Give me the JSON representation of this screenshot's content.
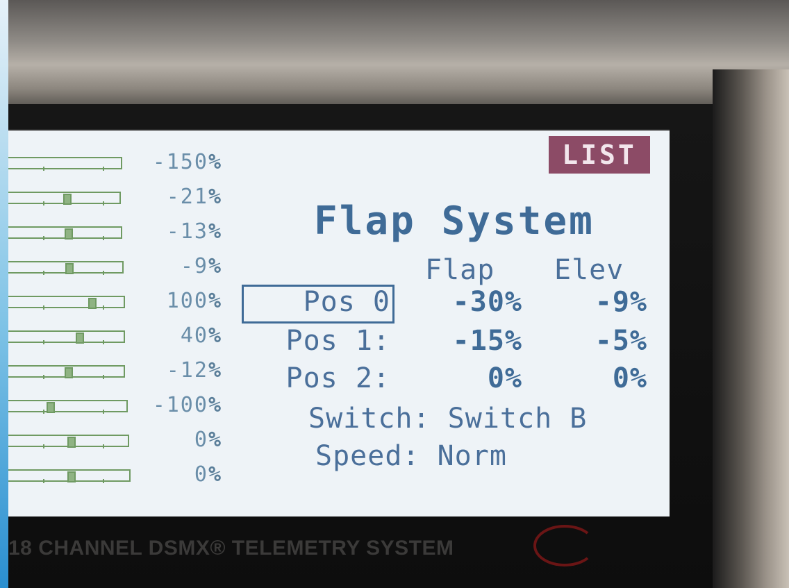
{
  "list_button": {
    "label": "LIST"
  },
  "channels": [
    {
      "value": "-150",
      "unit": "%",
      "level": -1.5
    },
    {
      "value": "-21",
      "unit": "%",
      "level": -0.21
    },
    {
      "value": "-13",
      "unit": "%",
      "level": -0.13
    },
    {
      "value": "-9",
      "unit": "%",
      "level": -0.09
    },
    {
      "value": "100",
      "unit": "%",
      "level": 1.0
    },
    {
      "value": "40",
      "unit": "%",
      "level": 0.4
    },
    {
      "value": "-12",
      "unit": "%",
      "level": -0.12
    },
    {
      "value": "-100",
      "unit": "%",
      "level": -1.0
    },
    {
      "value": "0",
      "unit": "%",
      "level": 0.0
    },
    {
      "value": "0",
      "unit": "%",
      "level": 0.0
    }
  ],
  "screen": {
    "title": "Flap System",
    "headers": {
      "flap": "Flap",
      "elev": "Elev"
    },
    "rows": [
      {
        "label": "Pos 0",
        "flap": "-30%",
        "elev": "-9%"
      },
      {
        "label": "Pos 1:",
        "flap": "-15%",
        "elev": "-5%"
      },
      {
        "label": "Pos 2:",
        "flap": "0%",
        "elev": "0%"
      }
    ],
    "switch_text": "Switch: Switch B",
    "speed_text": "Speed: Norm"
  },
  "footer": {
    "text": "18 CHANNEL DSMX® TELEMETRY SYSTEM"
  },
  "colors": {
    "lcd_text": "#466c95",
    "list_bg": "#8c4b66",
    "bar_green": "#6f9a62"
  }
}
